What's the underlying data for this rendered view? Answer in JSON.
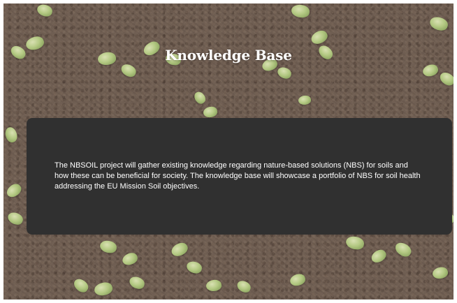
{
  "page": {
    "title": "Knowledge Base"
  },
  "intro": {
    "text": "The NBSOIL project will gather existing knowledge regarding nature-based solutions (NBS) for soils and how these can be beneficial for society. The knowledge base will showcase a portfolio of NBS for soil health addressing the EU Mission Soil objectives."
  },
  "colors": {
    "card_background": "#303030",
    "title_text": "#ffffff",
    "body_text": "#ffffff",
    "soil": "#6f5e52",
    "sprout": "#b8cf86"
  }
}
